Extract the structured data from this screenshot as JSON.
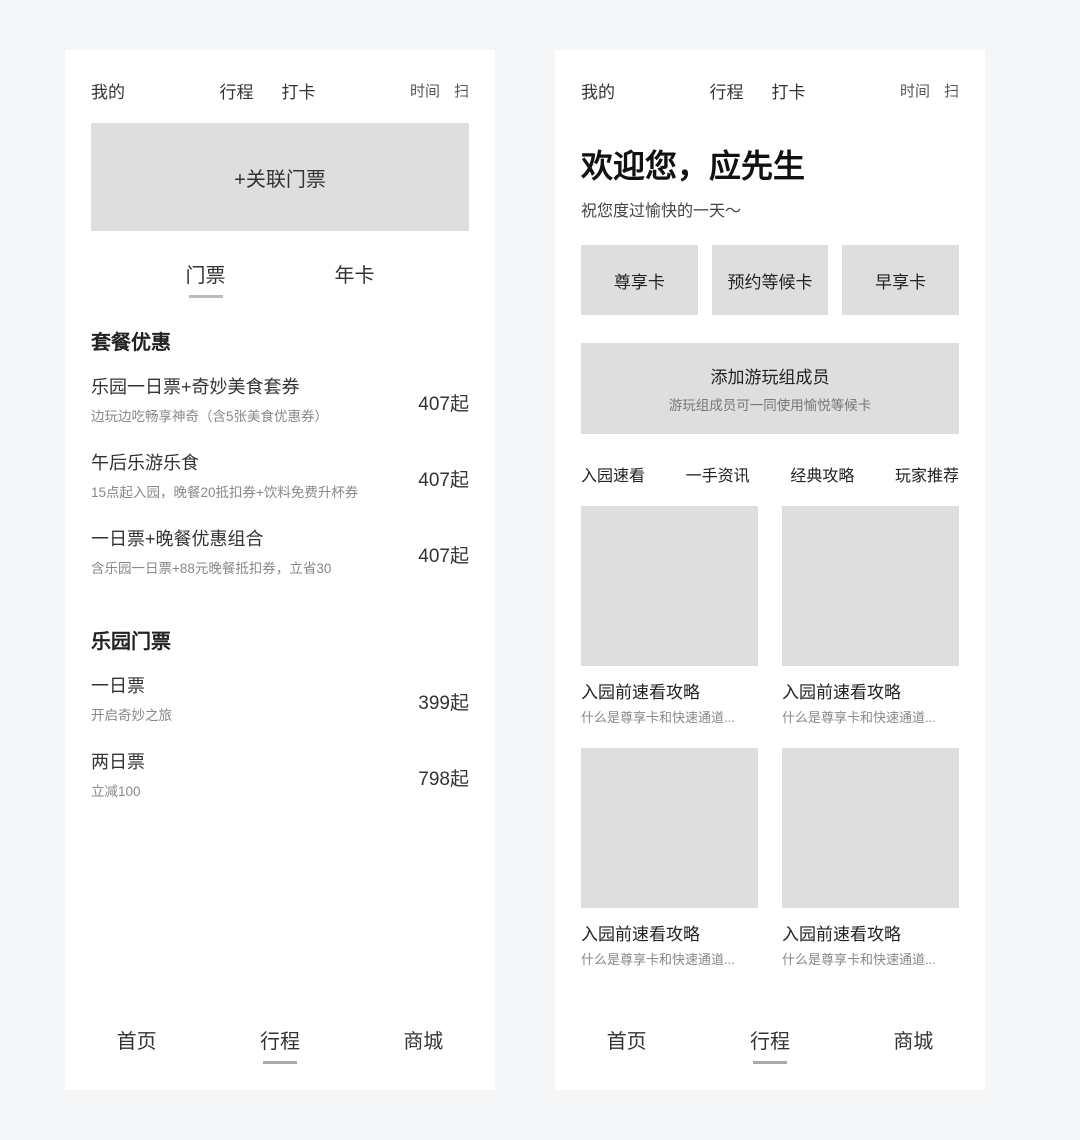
{
  "screen1": {
    "top": {
      "left": "我的",
      "center": [
        "行程",
        "打卡"
      ],
      "right": [
        "时间",
        "扫"
      ]
    },
    "linkTicket": "+关联门票",
    "tabs": {
      "items": [
        "门票",
        "年卡"
      ],
      "activeIndex": 0
    },
    "sections": [
      {
        "title": "套餐优惠",
        "deals": [
          {
            "title": "乐园一日票+奇妙美食套券",
            "sub": "边玩边吃畅享神奇（含5张美食优惠券）",
            "price": "407起"
          },
          {
            "title": "午后乐游乐食",
            "sub": "15点起入园，晚餐20抵扣券+饮料免费升杯券",
            "price": "407起"
          },
          {
            "title": "一日票+晚餐优惠组合",
            "sub": "含乐园一日票+88元晚餐抵扣券，立省30",
            "price": "407起"
          }
        ]
      },
      {
        "title": "乐园门票",
        "deals": [
          {
            "title": "一日票",
            "sub": "开启奇妙之旅",
            "price": "399起"
          },
          {
            "title": "两日票",
            "sub": "立减100",
            "price": "798起"
          }
        ]
      }
    ],
    "bottomNav": {
      "items": [
        "首页",
        "行程",
        "商城"
      ],
      "activeIndex": 1
    }
  },
  "screen2": {
    "top": {
      "left": "我的",
      "center": [
        "行程",
        "打卡"
      ],
      "right": [
        "时间",
        "扫"
      ]
    },
    "welcomeTitle": "欢迎您，应先生",
    "welcomeSub": "祝您度过愉快的一天～",
    "cards": [
      "尊享卡",
      "预约等候卡",
      "早享卡"
    ],
    "addGroup": {
      "title": "添加游玩组成员",
      "sub": "游玩组成员可一同使用愉悦等候卡"
    },
    "chips": [
      "入园速看",
      "一手资讯",
      "经典攻略",
      "玩家推荐"
    ],
    "feed": [
      {
        "title": "入园前速看攻略",
        "sub": "什么是尊享卡和快速通道..."
      },
      {
        "title": "入园前速看攻略",
        "sub": "什么是尊享卡和快速通道..."
      },
      {
        "title": "入园前速看攻略",
        "sub": "什么是尊享卡和快速通道..."
      },
      {
        "title": "入园前速看攻略",
        "sub": "什么是尊享卡和快速通道..."
      }
    ],
    "bottomNav": {
      "items": [
        "首页",
        "行程",
        "商城"
      ],
      "activeIndex": 1
    }
  }
}
